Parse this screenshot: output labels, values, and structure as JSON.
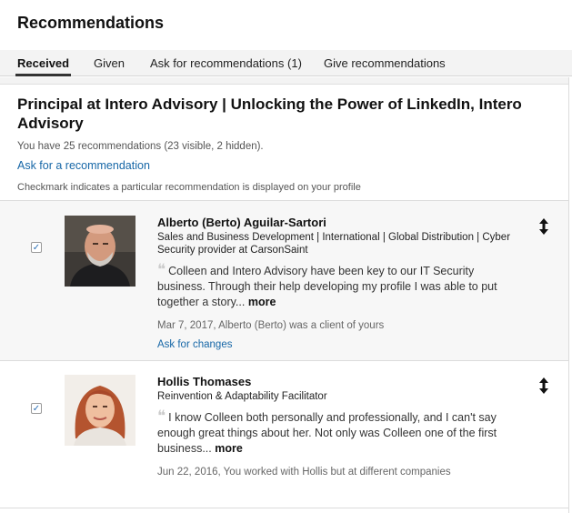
{
  "header": {
    "title": "Recommendations"
  },
  "tabs": [
    {
      "label": "Received"
    },
    {
      "label": "Given"
    },
    {
      "label": "Ask for recommendations (1)"
    },
    {
      "label": "Give recommendations"
    }
  ],
  "active_tab": "Received",
  "summary": {
    "position_title": "Principal at Intero Advisory | Unlocking the Power of LinkedIn, Intero Advisory",
    "count_text": "You have 25 recommendations (23 visible, 2 hidden).",
    "ask_link": "Ask for a recommendation",
    "note": "Checkmark indicates a particular recommendation is displayed on your profile"
  },
  "recommendations": [
    {
      "checked": true,
      "checkmark": "✓",
      "name": "Alberto (Berto) Aguilar-Sartori",
      "headline": "Sales and Business Development | International | Global Distribution | Cyber Security provider at CarsonSaint",
      "quote": "Colleen and Intero Advisory have been key to our IT Security business. Through their help developing my profile I was able to put together a story...",
      "more_label": "more",
      "date_relation": "Mar 7, 2017, Alberto (Berto) was a client of yours",
      "action_label": "Ask for changes"
    },
    {
      "checked": true,
      "checkmark": "✓",
      "name": "Hollis Thomases",
      "headline": "Reinvention & Adaptability Facilitator",
      "quote": "I know Colleen both personally and professionally, and I can't say enough great things about her. Not only was Colleen one of the first business...",
      "more_label": "more",
      "date_relation": "Jun 22, 2016, You worked with Hollis but at different companies"
    }
  ],
  "icons": {
    "quote": "quote-icon",
    "reorder": "reorder-arrows-icon",
    "checkbox": "checkbox-icon"
  },
  "colors": {
    "link": "#1767a7",
    "tab_bar": "#f3f3f3",
    "card_shaded": "#f7f7f7"
  }
}
